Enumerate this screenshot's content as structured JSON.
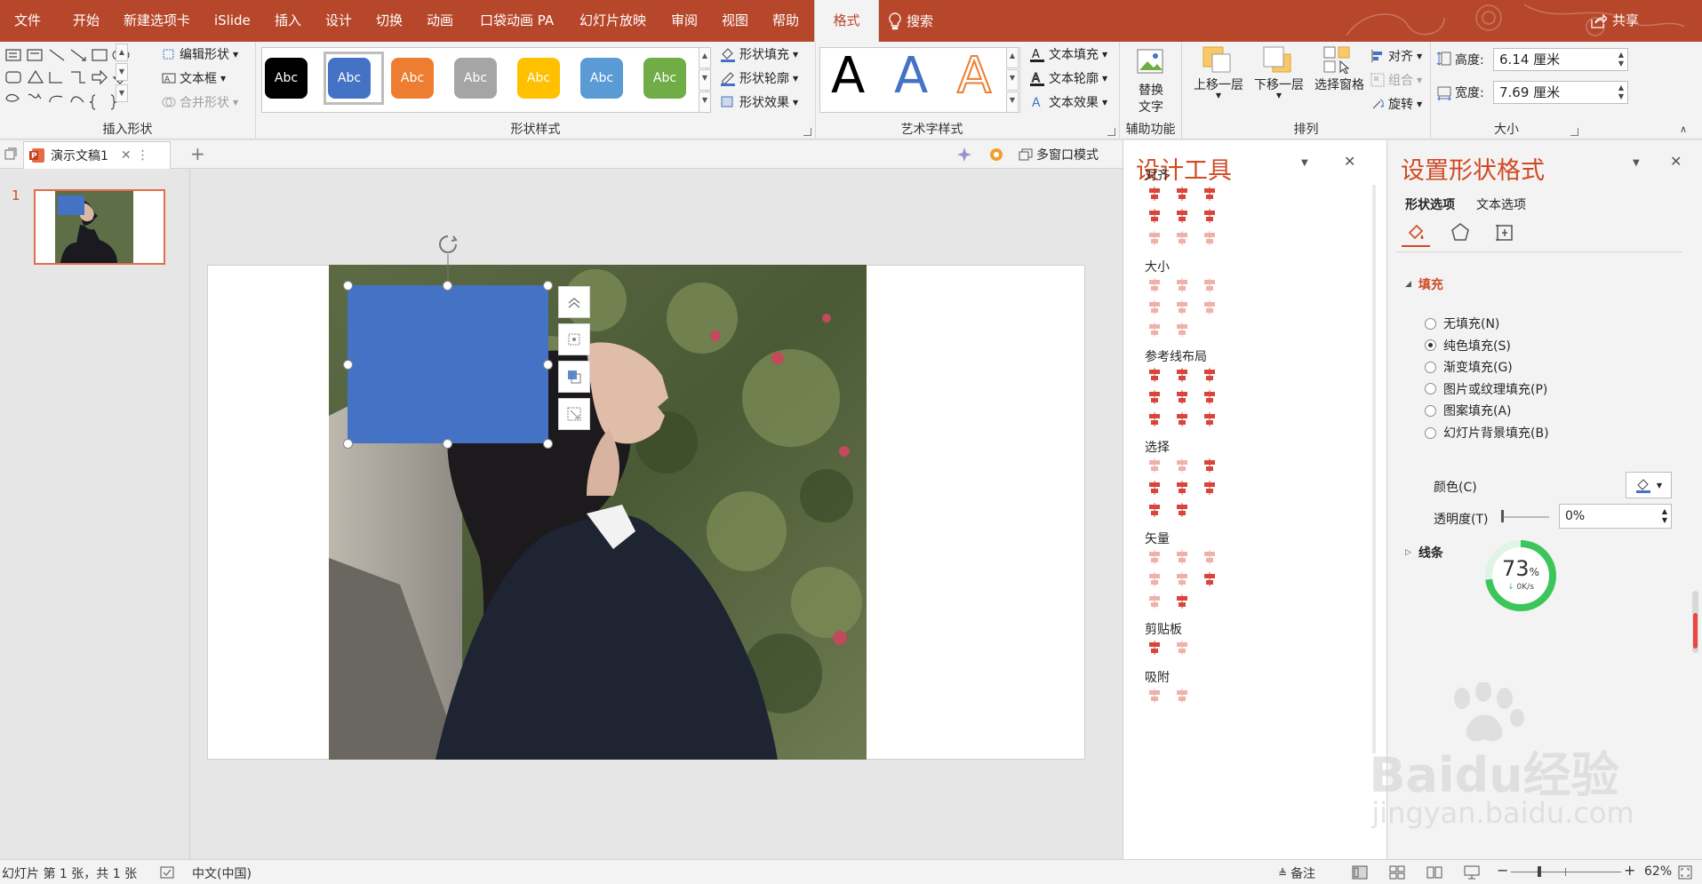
{
  "menu": {
    "tabs": [
      "文件",
      "开始",
      "新建选项卡",
      "iSlide",
      "插入",
      "设计",
      "切换",
      "动画",
      "口袋动画 PA",
      "幻灯片放映",
      "审阅",
      "视图",
      "帮助",
      "格式"
    ],
    "search": "搜索",
    "share": "共享"
  },
  "ribbon": {
    "insert_shapes": {
      "label": "插入形状",
      "edit_shape": "编辑形状",
      "text_box": "文本框",
      "merge_shapes": "合并形状"
    },
    "shape_styles": {
      "label": "形状样式",
      "swatches": [
        {
          "text": "Abc",
          "color": "#000000"
        },
        {
          "text": "Abc",
          "color": "#4472c4"
        },
        {
          "text": "Abc",
          "color": "#ed7d31"
        },
        {
          "text": "Abc",
          "color": "#a5a5a5"
        },
        {
          "text": "Abc",
          "color": "#ffc000"
        },
        {
          "text": "Abc",
          "color": "#5b9bd5"
        },
        {
          "text": "Abc",
          "color": "#70ad47"
        }
      ],
      "fill": "形状填充",
      "outline": "形状轮廓",
      "effects": "形状效果"
    },
    "wordart": {
      "label": "艺术字样式",
      "letters": [
        "A",
        "A",
        "A"
      ],
      "text_fill": "文本填充",
      "text_outline": "文本轮廓",
      "text_effects": "文本效果"
    },
    "accessibility": {
      "label": "辅助功能",
      "alt_text_1": "替换",
      "alt_text_2": "文字"
    },
    "arrange": {
      "label": "排列",
      "bring_forward": "上移一层",
      "send_backward": "下移一层",
      "selection_pane": "选择窗格",
      "align": "对齐",
      "group": "组合",
      "rotate": "旋转"
    },
    "size": {
      "label": "大小",
      "height_label": "高度:",
      "height_value": "6.14 厘米",
      "width_label": "宽度:",
      "width_value": "7.69 厘米"
    }
  },
  "doc_tab": {
    "name": "演示文稿1",
    "multi_window": "多窗口模式"
  },
  "thumbnail": {
    "number": "1"
  },
  "design_pane": {
    "title": "设计工具",
    "sections": [
      "对齐",
      "大小",
      "参考线布局",
      "选择",
      "矢量",
      "剪贴板",
      "吸附"
    ]
  },
  "format_pane": {
    "title": "设置形状格式",
    "tabs": [
      "形状选项",
      "文本选项"
    ],
    "fill_header": "填充",
    "fill_options": [
      "无填充(N)",
      "纯色填充(S)",
      "渐变填充(G)",
      "图片或纹理填充(P)",
      "图案填充(A)",
      "幻灯片背景填充(B)"
    ],
    "selected_fill_index": 1,
    "color_label": "颜色(C)",
    "transparency_label": "透明度(T)",
    "transparency_value": "0%",
    "line_header": "线条",
    "speed_widget": {
      "percent": "73",
      "percent_sign": "%",
      "rate": "0K/s"
    }
  },
  "status": {
    "slide_info": "幻灯片 第 1 张，共 1 张",
    "language": "中文(中国)",
    "notes": "备注",
    "zoom": "62%"
  },
  "watermark": {
    "brand": "Baidu经验",
    "url": "jingyan.baidu.com"
  },
  "colors": {
    "accent": "#b7472a",
    "pane_title": "#d04a24",
    "shape_fill": "#4472c4",
    "thumb_border": "#e46c4b"
  }
}
